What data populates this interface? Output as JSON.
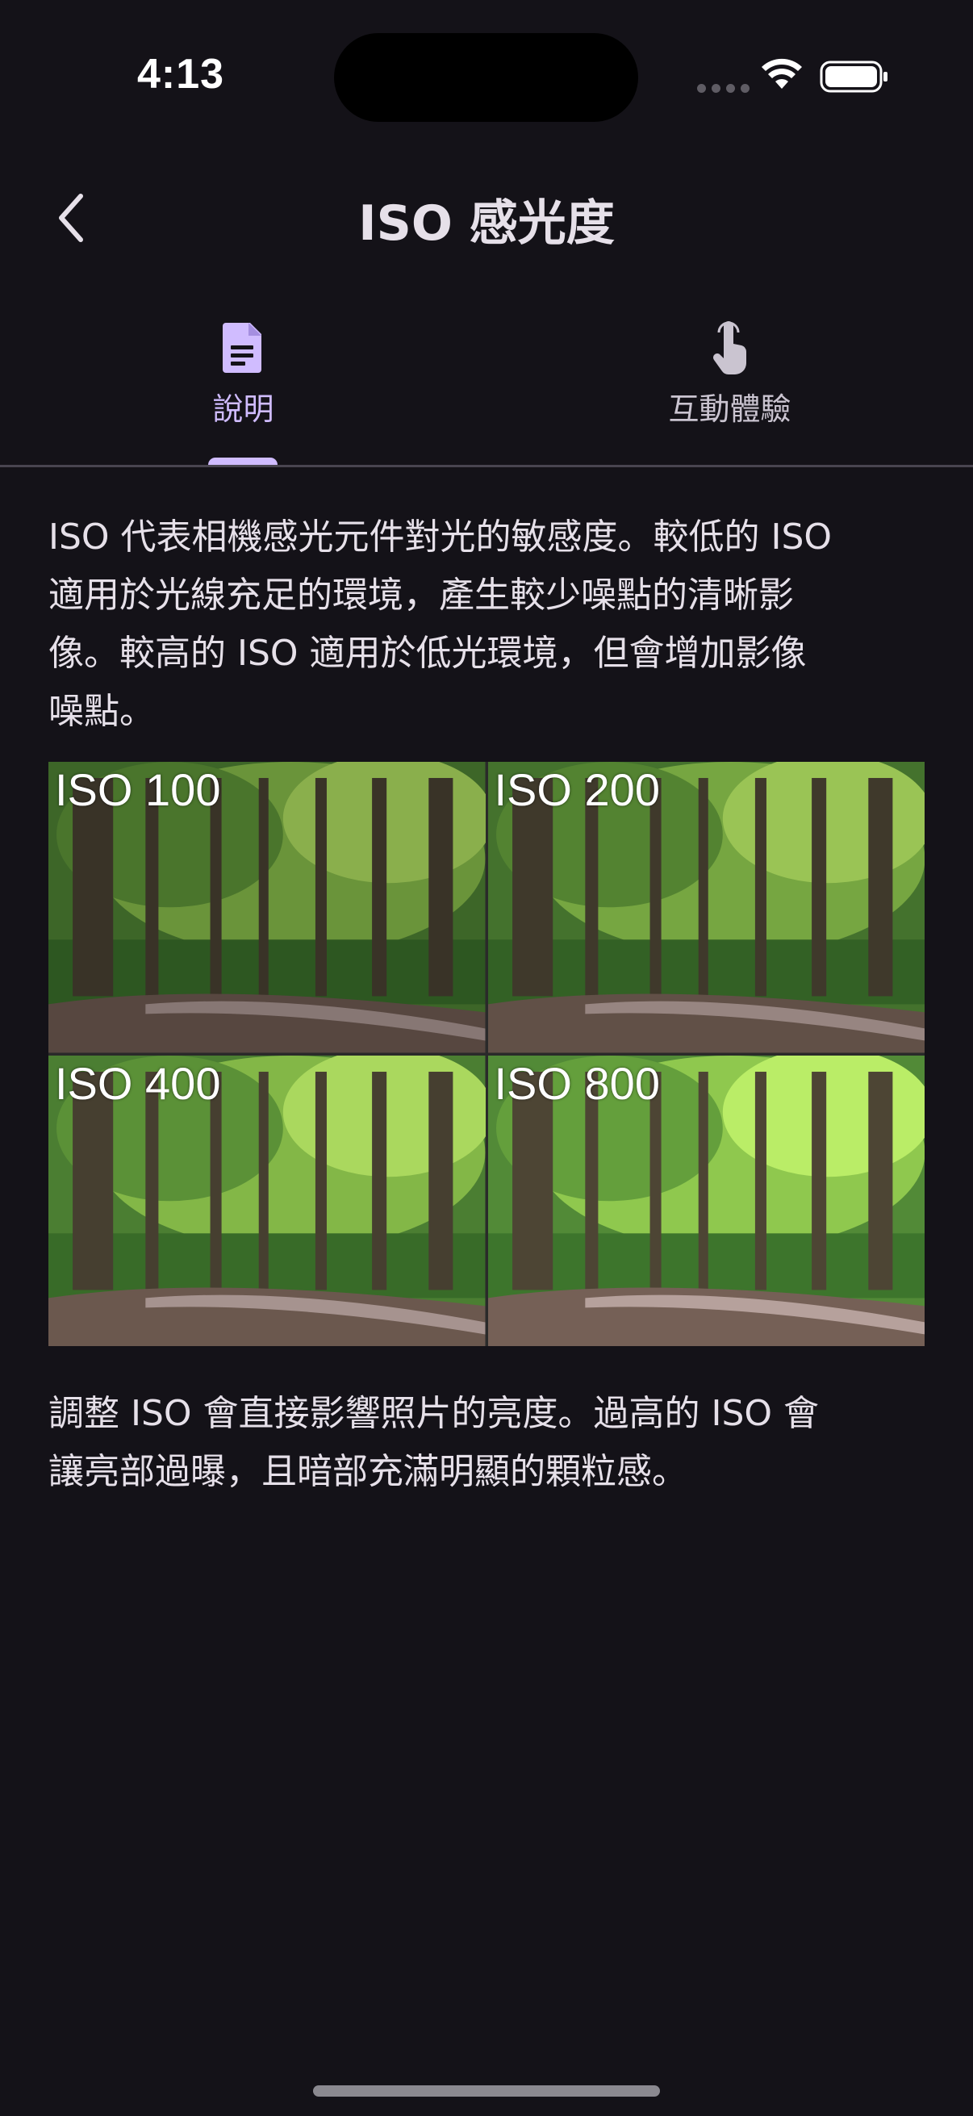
{
  "status_bar": {
    "time": "4:13"
  },
  "app_bar": {
    "title": "ISO 感光度",
    "back_icon": "chevron-left-icon"
  },
  "tabs": [
    {
      "label": "說明",
      "icon": "document-icon",
      "selected": true
    },
    {
      "label": "互動體驗",
      "icon": "touch-hand-icon",
      "selected": false
    }
  ],
  "content": {
    "intro_lines": [
      "ISO 代表相機感光元件對光的敏感度。較低的 ISO",
      "適用於光線充足的環境，產生較少噪點的清晰影",
      "像。較高的 ISO 適用於低光環境，但會增加影像",
      "噪點。"
    ],
    "iso_samples": [
      {
        "label": "ISO 100",
        "brightness": 0.55
      },
      {
        "label": "ISO 200",
        "brightness": 0.7
      },
      {
        "label": "ISO 400",
        "brightness": 0.85
      },
      {
        "label": "ISO 800",
        "brightness": 1.0
      }
    ],
    "outro_lines": [
      "調整 ISO 會直接影響照片的亮度。過高的 ISO 會",
      "讓亮部過曝，且暗部充滿明顯的顆粒感。"
    ]
  },
  "colors": {
    "background": "#141218",
    "accent": "#d0bcff",
    "text": "#e6e0e9",
    "divider": "#49454f"
  }
}
